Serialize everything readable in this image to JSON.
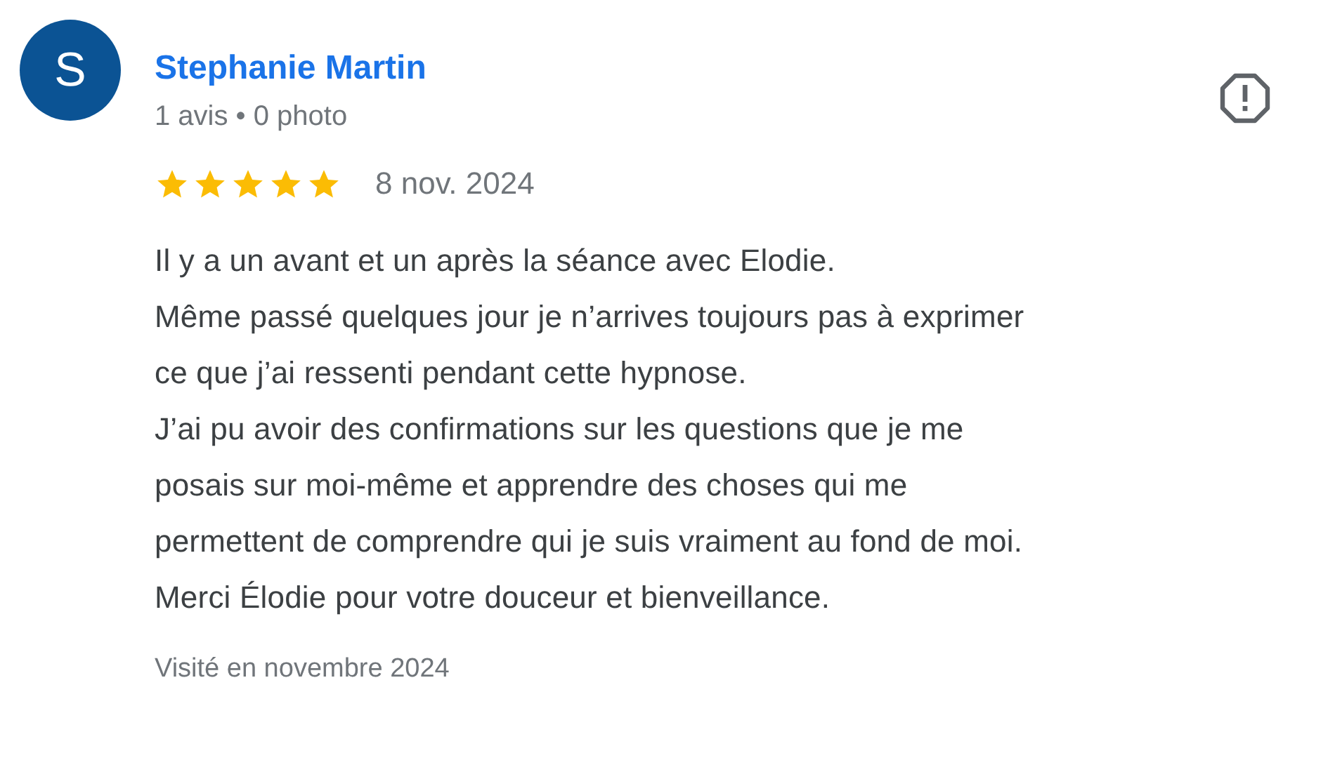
{
  "review": {
    "avatar_letter": "S",
    "author": "Stephanie Martin",
    "meta": "1 avis • 0 photo",
    "stars": 5,
    "date": "8 nov. 2024",
    "text": "Il y a un avant et un après la séance avec Elodie.\nMême passé quelques jour je n’arrives toujours pas à exprimer\nce que j’ai ressenti pendant cette hypnose.\nJ’ai pu avoir des confirmations sur les questions que je me\nposais sur moi-même et apprendre des choses qui me\npermettent de comprendre qui je suis vraiment au fond de moi.\nMerci Élodie pour votre douceur et bienveillance.",
    "visited": "Visité en novembre 2024"
  }
}
